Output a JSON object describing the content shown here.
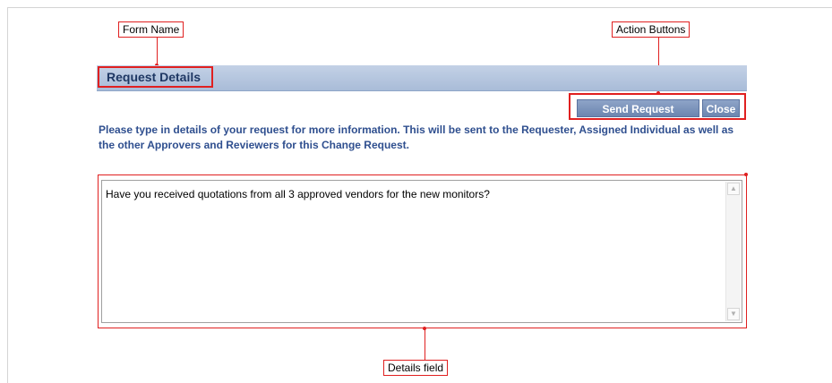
{
  "annotations": {
    "form_name": "Form Name",
    "action_buttons": "Action Buttons",
    "details_field": "Details field"
  },
  "form": {
    "title": "Request Details",
    "buttons": {
      "send": "Send Request",
      "close": "Close"
    },
    "instructions": "Please type in details of your request for more information. This will be sent to the Requester, Assigned Individual as well as the other Approvers and Reviewers for this Change Request.",
    "details_value": "Have you received quotations from all 3 approved vendors for the new monitors?"
  },
  "icons": {
    "scroll_up": "chevron-up-icon",
    "scroll_down": "chevron-down-icon"
  },
  "colors": {
    "annotation": "#e02020",
    "header_bar": "#b6c6de",
    "title_text": "#1f3864",
    "button_bg": "#7b93bd",
    "instruction_text": "#2f4f8f"
  }
}
